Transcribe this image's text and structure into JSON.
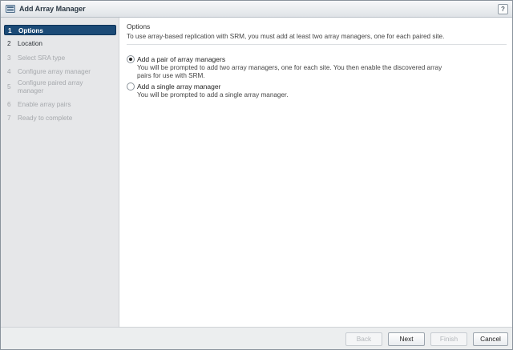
{
  "window": {
    "title": "Add Array Manager",
    "help_label": "?"
  },
  "steps": [
    {
      "num": "1",
      "label": "Options",
      "state": "active"
    },
    {
      "num": "2",
      "label": "Location",
      "state": "enabled"
    },
    {
      "num": "3",
      "label": "Select SRA type",
      "state": "disabled"
    },
    {
      "num": "4",
      "label": "Configure array manager",
      "state": "disabled"
    },
    {
      "num": "5",
      "label": "Configure paired array manager",
      "state": "disabled"
    },
    {
      "num": "6",
      "label": "Enable array pairs",
      "state": "disabled"
    },
    {
      "num": "7",
      "label": "Ready to complete",
      "state": "disabled"
    }
  ],
  "main": {
    "title": "Options",
    "description": "To use array-based replication with SRM, you must add at least two array managers, one for each paired site.",
    "options": [
      {
        "label": "Add a pair of array managers",
        "description": "You will be prompted to add two array managers, one for each site. You then enable the discovered array pairs for use with SRM.",
        "selected": true
      },
      {
        "label": "Add a single array manager",
        "description": "You will be prompted to add a single array manager.",
        "selected": false
      }
    ]
  },
  "footer": {
    "back": "Back",
    "next": "Next",
    "finish": "Finish",
    "cancel": "Cancel"
  },
  "colors": {
    "active_step_bg": "#1b4a76",
    "sidebar_bg": "#e6e7e9",
    "footer_bg": "#eceeef"
  },
  "icons": {
    "title_icon": "array-manager-icon"
  }
}
